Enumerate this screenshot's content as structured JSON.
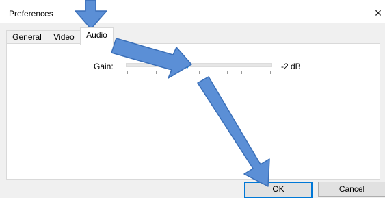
{
  "window": {
    "title": "Preferences",
    "close_glyph": "×"
  },
  "tabs": [
    {
      "label": "General",
      "selected": false
    },
    {
      "label": "Video",
      "selected": false
    },
    {
      "label": "Audio",
      "selected": true
    }
  ],
  "audio": {
    "gain_label": "Gain:",
    "gain_value_text": "-2 dB",
    "slider": {
      "position_fraction": 0.42,
      "tick_count": 11
    }
  },
  "buttons": {
    "ok": "OK",
    "cancel": "Cancel"
  },
  "colors": {
    "accent": "#0078d7",
    "annotation_arrow": "#5b8fd6"
  },
  "annotation_arrows": 3
}
